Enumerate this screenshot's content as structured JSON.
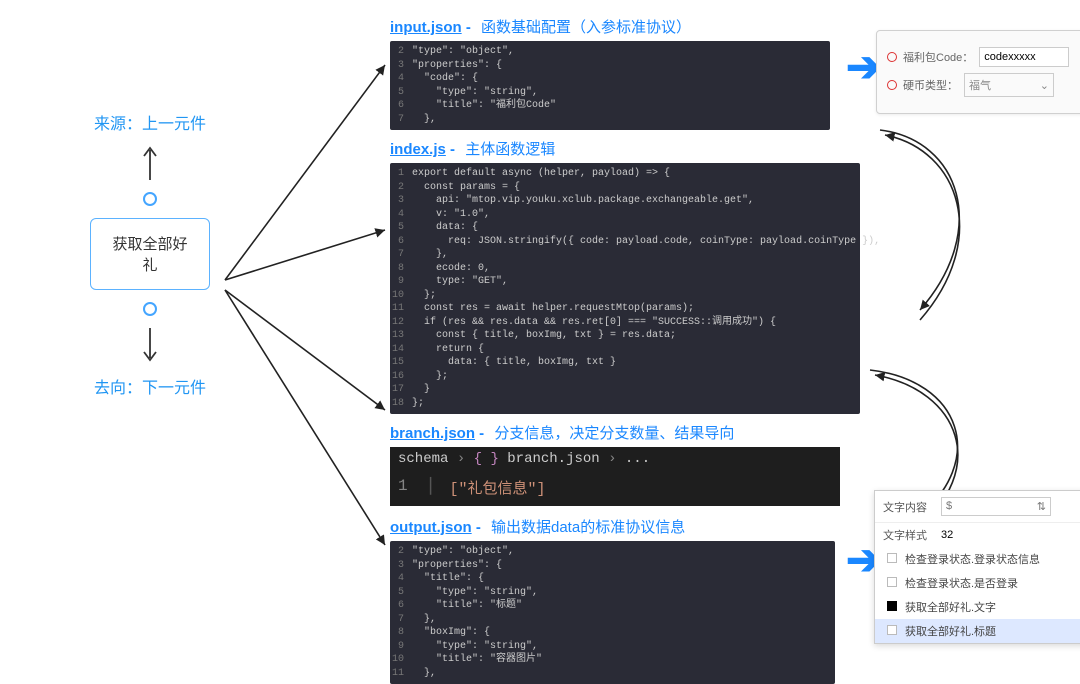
{
  "left": {
    "source_label": "来源：上一元件",
    "node_label": "获取全部好礼",
    "dest_label": "去向：下一元件"
  },
  "sections": {
    "input": {
      "file": "input.json",
      "sep": " - ",
      "desc": "函数基础配置（入参标准协议）"
    },
    "index": {
      "file": "index.js",
      "sep": " - ",
      "desc": "主体函数逻辑"
    },
    "branch": {
      "file": "branch.json",
      "sep": " - ",
      "desc": "分支信息，决定分支数量、结果导向"
    },
    "output": {
      "file": "output.json",
      "sep": " - ",
      "desc": "输出数据data的标准协议信息"
    }
  },
  "input_code": [
    "\"type\": \"object\",",
    "\"properties\": {",
    "  \"code\": {",
    "    \"type\": \"string\",",
    "    \"title\": \"福利包Code\"",
    "  },"
  ],
  "index_code": [
    "export default async (helper, payload) => {",
    "  const params = {",
    "    api: \"mtop.vip.youku.xclub.package.exchangeable.get\",",
    "    v: \"1.0\",",
    "    data: {",
    "      req: JSON.stringify({ code: payload.code, coinType: payload.coinType }),",
    "    },",
    "    ecode: 0,",
    "    type: \"GET\",",
    "  };",
    "  const res = await helper.requestMtop(params);",
    "  if (res && res.data && res.ret[0] === \"SUCCESS::调用成功\") {",
    "    const { title, boxImg, txt } = res.data;",
    "    return {",
    "      data: { title, boxImg, txt }",
    "    };",
    "  }",
    "};"
  ],
  "branch": {
    "crumb_schema": "schema",
    "crumb_file": "branch.json",
    "crumb_dots": "...",
    "line_num": "1",
    "content": "[\"礼包信息\"]"
  },
  "output_code": [
    "\"type\": \"object\",",
    "\"properties\": {",
    "  \"title\": {",
    "    \"type\": \"string\",",
    "    \"title\": \"标题\"",
    "  },",
    "  \"boxImg\": {",
    "    \"type\": \"string\",",
    "    \"title\": \"容器图片\"",
    "  },"
  ],
  "form1": {
    "l1": "福利包Code：",
    "v1": "codexxxxx",
    "l2": "硬币类型：",
    "v2": "福气"
  },
  "menu": {
    "label_content": "文字内容",
    "val_content": "$",
    "label_style": "文字样式",
    "val_style": "32",
    "items": [
      "检查登录状态.登录状态信息",
      "检查登录状态.是否登录",
      "获取全部好礼.文字",
      "获取全部好礼.标题"
    ]
  }
}
